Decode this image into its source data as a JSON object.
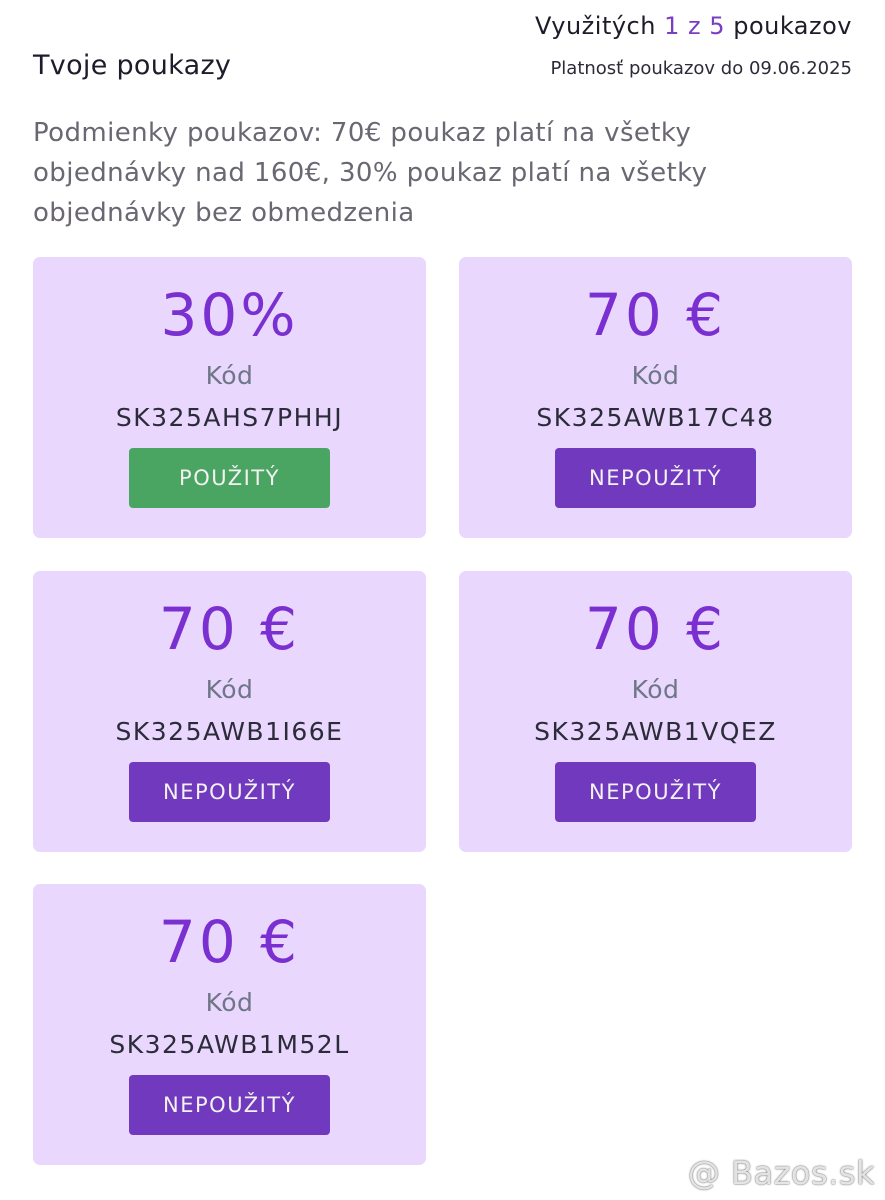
{
  "header": {
    "title": "Tvoje poukazy",
    "usage_prefix": "Využitých",
    "usage_used": "1",
    "usage_mid": "z",
    "usage_total": "5",
    "usage_suffix": "poukazov",
    "validity": "Platnosť poukazov do 09.06.2025"
  },
  "conditions": "Podmienky poukazov: 70€ poukaz platí na všetky objednávky nad 160€, 30% poukaz platí na všetky objednávky bez obmedzenia",
  "vouchers": [
    {
      "value": "30%",
      "code_label": "Kód",
      "code": "SK325AHS7PHHJ",
      "status": "POUŽITÝ",
      "used": true
    },
    {
      "value": "70 €",
      "code_label": "Kód",
      "code": "SK325AWB17C48",
      "status": "NEPOUŽITÝ",
      "used": false
    },
    {
      "value": "70 €",
      "code_label": "Kód",
      "code": "SK325AWB1I66E",
      "status": "NEPOUŽITÝ",
      "used": false
    },
    {
      "value": "70 €",
      "code_label": "Kód",
      "code": "SK325AWB1VQEZ",
      "status": "NEPOUŽITÝ",
      "used": false
    },
    {
      "value": "70 €",
      "code_label": "Kód",
      "code": "SK325AWB1M52L",
      "status": "NEPOUŽITÝ",
      "used": false
    }
  ],
  "colors": {
    "accent": "#7a2fd0",
    "card_background": "#e9d7fd",
    "used_button": "#4aa563",
    "unused_button": "#7139be"
  },
  "watermark": "@ Bazos.sk"
}
